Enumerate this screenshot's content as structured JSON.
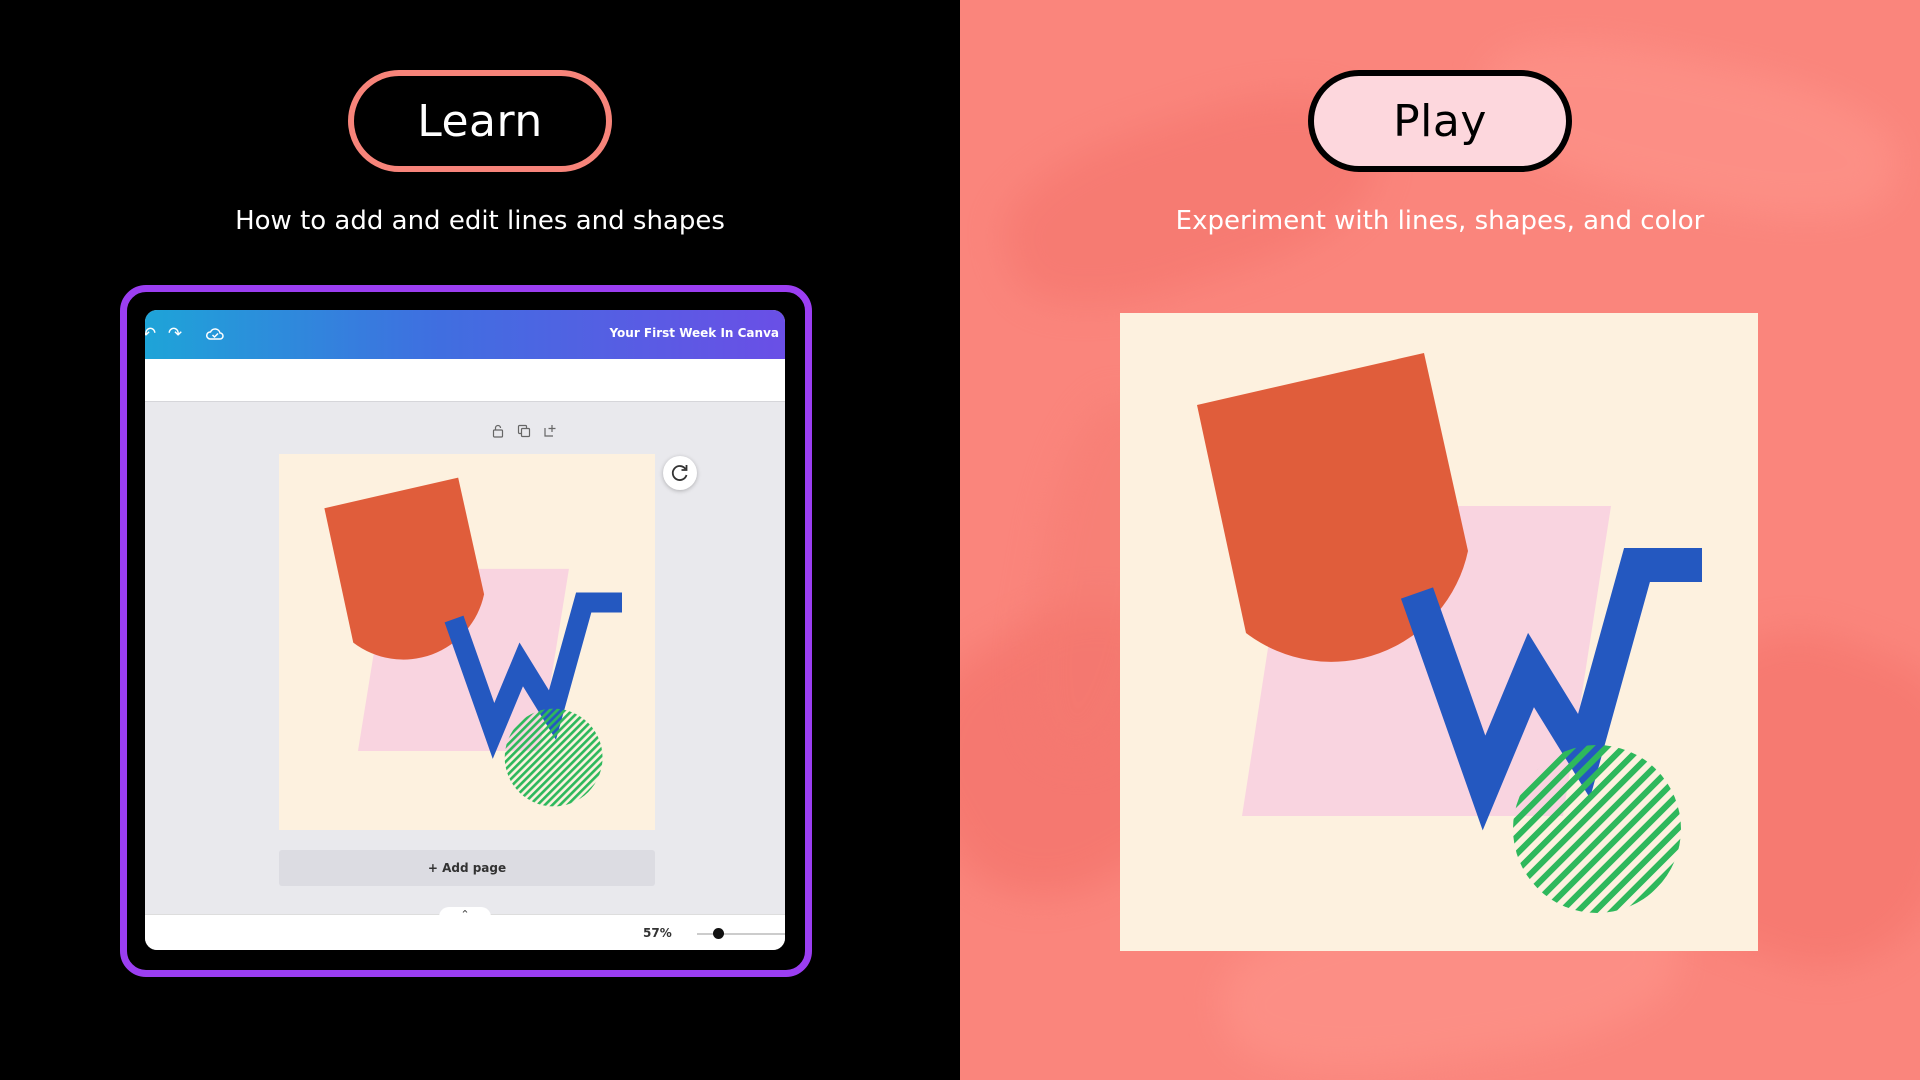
{
  "learn": {
    "pill_label": "Learn",
    "subtitle": "How to add and edit lines and shapes",
    "device": {
      "doc_title": "Your First Week In Canva",
      "add_page_label": "+ Add page",
      "zoom_label": "57%",
      "zoom_level_percent": 57
    }
  },
  "play": {
    "pill_label": "Play",
    "subtitle": "Experiment with lines, shapes, and color"
  },
  "colors": {
    "left_bg": "#000000",
    "right_bg": "#fa857c",
    "accent_purple": "#9b3ef2",
    "accent_coral": "#f7847a",
    "shape_orange": "#e05d3b",
    "shape_pink": "#f9d4e0",
    "shape_blue": "#2458c0",
    "shape_green": "#2eb85c",
    "page_cream": "#fdf1df"
  },
  "icons": {
    "undo": "undo-icon",
    "redo": "redo-icon",
    "cloud": "cloud-saved-icon",
    "lock": "lock-icon",
    "duplicate": "duplicate-icon",
    "add": "add-page-icon",
    "refresh": "refresh-icon",
    "chevron": "chevron-up-icon"
  }
}
